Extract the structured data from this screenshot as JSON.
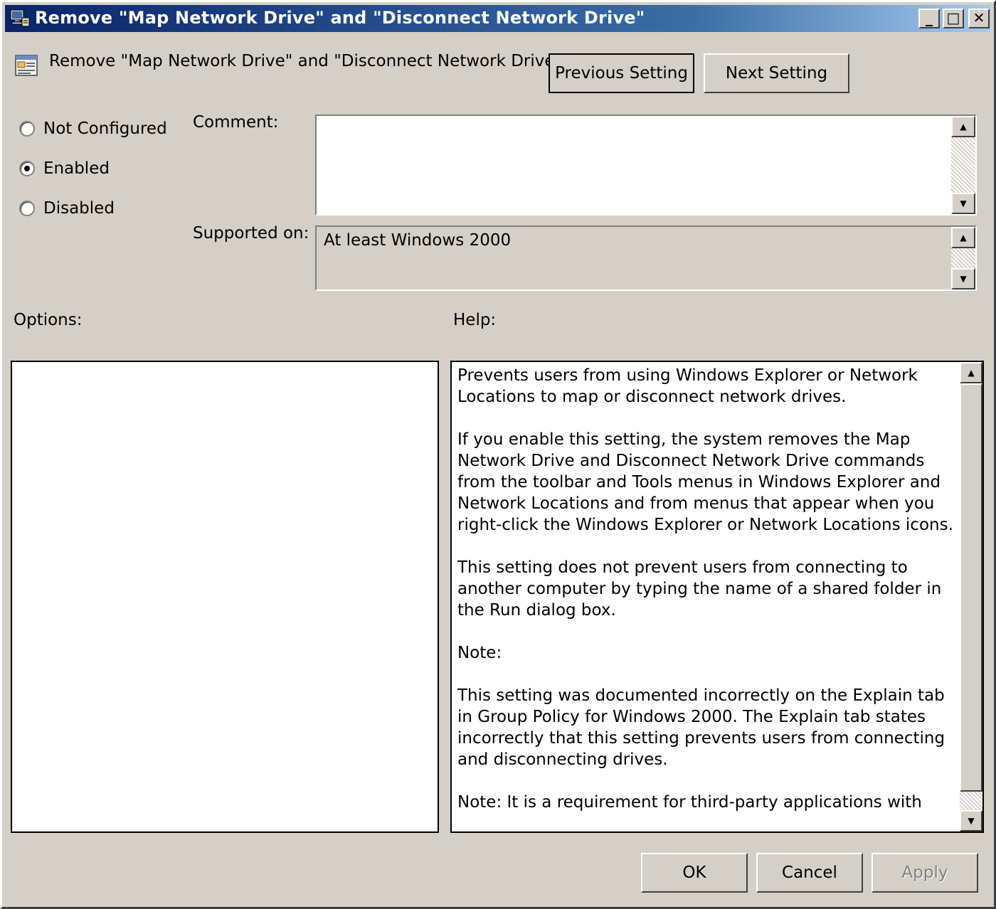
{
  "window": {
    "title": "Remove \"Map Network Drive\" and \"Disconnect Network Drive\"",
    "minimize": "_",
    "maximize": "□",
    "close": "✕"
  },
  "header": {
    "policy_name": "Remove \"Map Network Drive\" and \"Disconnect Network Drive\"",
    "previous_label": "Previous Setting",
    "next_label": "Next Setting"
  },
  "state": {
    "options": [
      {
        "label": "Not Configured",
        "checked": false
      },
      {
        "label": "Enabled",
        "checked": true
      },
      {
        "label": "Disabled",
        "checked": false
      }
    ]
  },
  "comment": {
    "label": "Comment:",
    "value": ""
  },
  "supported": {
    "label": "Supported on:",
    "value": "At least Windows 2000"
  },
  "options_label": "Options:",
  "help": {
    "label": "Help:",
    "paragraphs": [
      "Prevents users from using Windows Explorer or Network Locations to map or disconnect network drives.",
      "If you enable this setting, the system removes the Map Network Drive and Disconnect Network Drive commands from the toolbar and Tools menus in Windows Explorer and Network Locations and from menus that appear when you right-click the Windows Explorer or Network Locations icons.",
      "This setting does not prevent users from connecting to another computer by typing the name of a shared folder in the Run dialog box.",
      "Note:",
      "This setting was documented incorrectly on the Explain tab in Group Policy for Windows 2000. The Explain tab states incorrectly that this setting prevents users from connecting and disconnecting drives.",
      "Note: It is a requirement for third-party applications with"
    ]
  },
  "footer": {
    "ok_label": "OK",
    "cancel_label": "Cancel",
    "apply_label": "Apply"
  },
  "icons": {
    "title_icon": "computer-network-icon",
    "policy_icon": "policy-setting-icon",
    "scroll_up": "▲",
    "scroll_down": "▼"
  }
}
